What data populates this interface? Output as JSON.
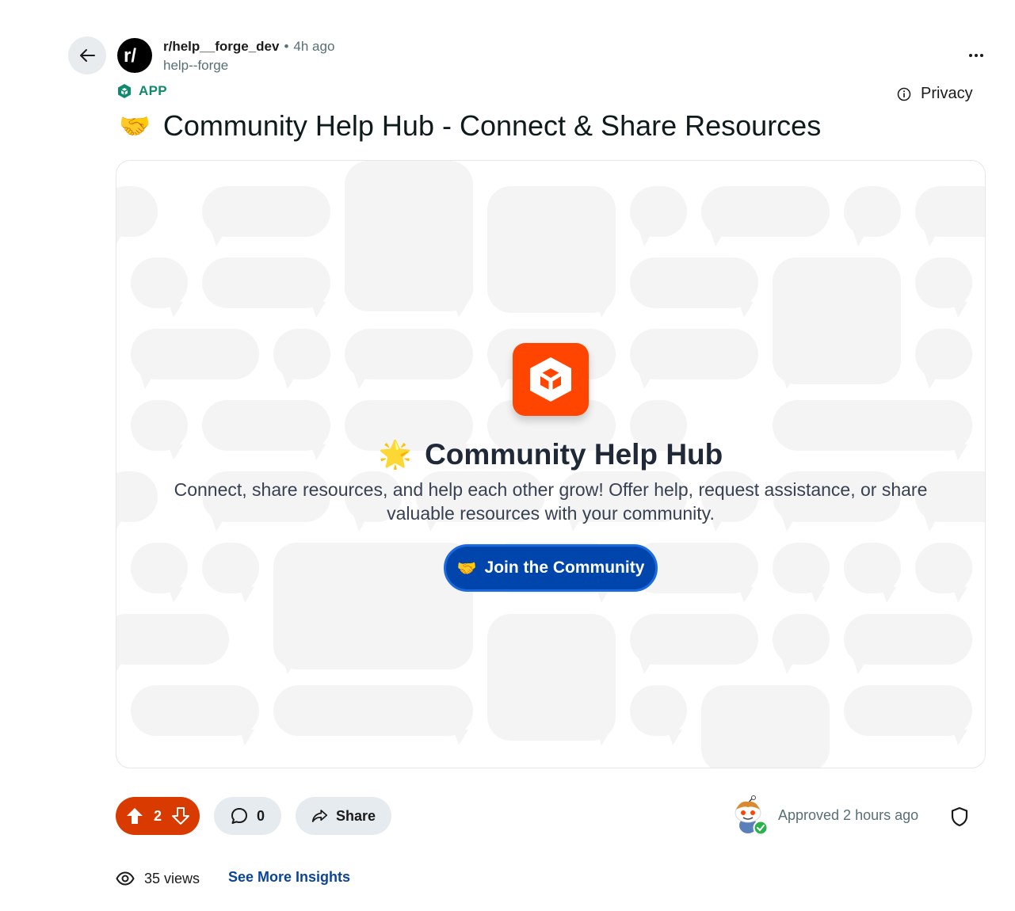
{
  "post": {
    "subreddit": "r/help__forge_dev",
    "separator": "•",
    "time": "4h ago",
    "author": "help--forge",
    "app_tag": "APP",
    "privacy_label": "Privacy",
    "title_emoji": "🤝",
    "title": "Community Help Hub - Connect & Share Resources"
  },
  "card": {
    "hub_emoji": "🌟",
    "hub_title": "Community Help Hub",
    "description": "Connect, share resources, and help each other grow! Offer help, request assistance, or share valuable resources with your community.",
    "join_emoji": "🤝",
    "join_label": "Join the Community"
  },
  "actions": {
    "vote_count": "2",
    "comment_count": "0",
    "share_label": "Share",
    "approved_text": "Approved 2 hours ago"
  },
  "footer": {
    "views": "35 views",
    "insights_label": "See More Insights"
  },
  "colors": {
    "upvote_bg": "#d93a00",
    "app_icon_bg": "#ff4500",
    "join_button_bg": "#0045ac",
    "app_tag": "#0f8a6c",
    "link": "#0a449b"
  },
  "icons": [
    "back-arrow-icon",
    "reddit-r-icon",
    "more-dots-icon",
    "app-cube-icon",
    "info-icon",
    "upvote-icon",
    "downvote-icon",
    "comment-icon",
    "share-icon",
    "shield-icon",
    "eye-icon"
  ]
}
